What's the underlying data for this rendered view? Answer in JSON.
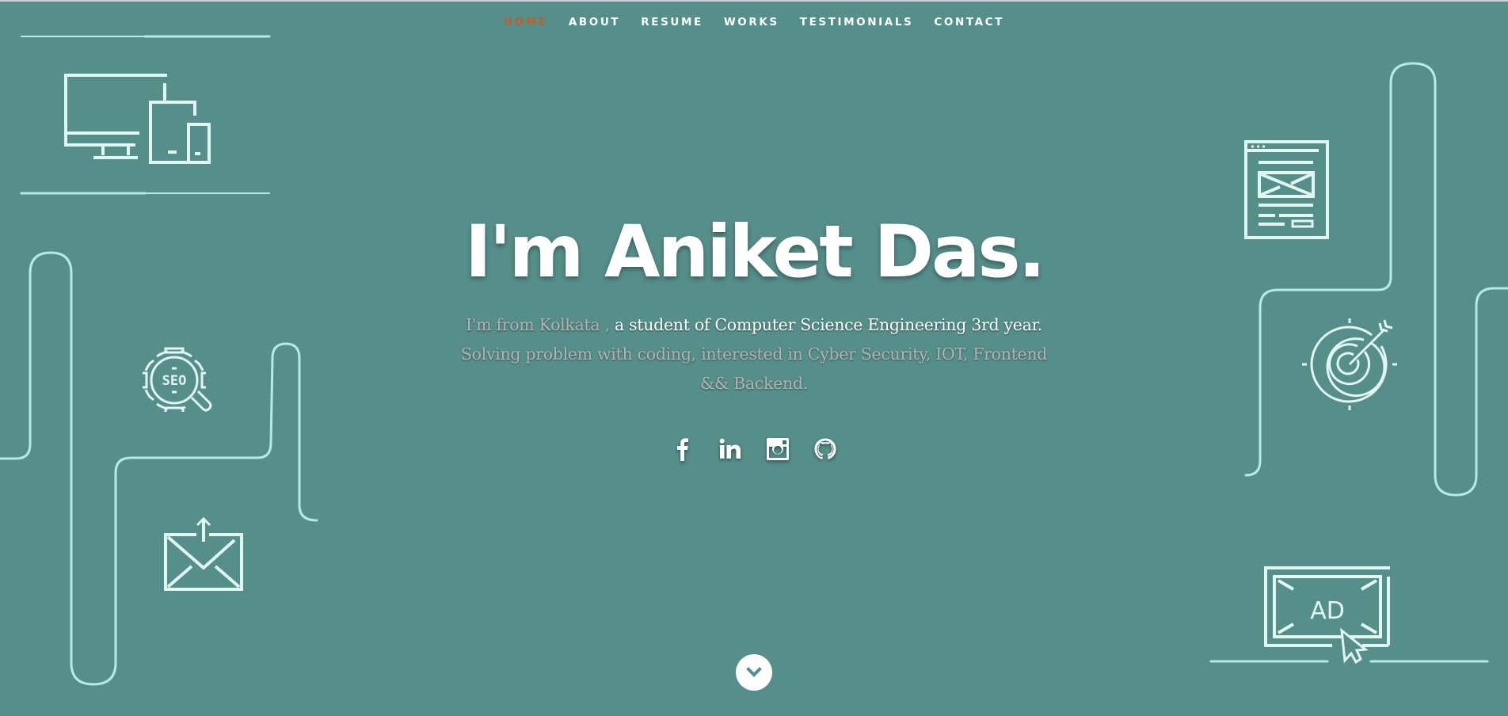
{
  "nav": {
    "items": [
      {
        "label": "HOME",
        "active": true
      },
      {
        "label": "ABOUT",
        "active": false
      },
      {
        "label": "RESUME",
        "active": false
      },
      {
        "label": "WORKS",
        "active": false
      },
      {
        "label": "TESTIMONIALS",
        "active": false
      },
      {
        "label": "CONTACT",
        "active": false
      }
    ],
    "active_color": "#cc5b1a"
  },
  "hero": {
    "title": "I'm Aniket Das.",
    "intro_part1": "I'm from Kolkata , ",
    "intro_highlight": "a student of Computer Science Engineering 3rd year.",
    "intro_part2": " Solving problem with coding, interested in Cyber Security, IOT, Frontend && Backend."
  },
  "social": [
    {
      "name": "facebook",
      "icon": "facebook-icon"
    },
    {
      "name": "linkedin",
      "icon": "linkedin-icon"
    },
    {
      "name": "instagram",
      "icon": "instagram-icon"
    },
    {
      "name": "github",
      "icon": "github-icon"
    }
  ],
  "decorations": [
    "devices-icon",
    "seo-gear-icon",
    "mail-send-icon",
    "web-layout-icon",
    "target-icon",
    "ad-click-icon"
  ],
  "scroll_down": {
    "icon": "chevron-down-icon"
  },
  "colors": {
    "background": "#568e8a",
    "line": "#b3ece6",
    "icon": "#e0f6f3",
    "text": "#ffffff",
    "muted_text": "#b3b5b5"
  }
}
